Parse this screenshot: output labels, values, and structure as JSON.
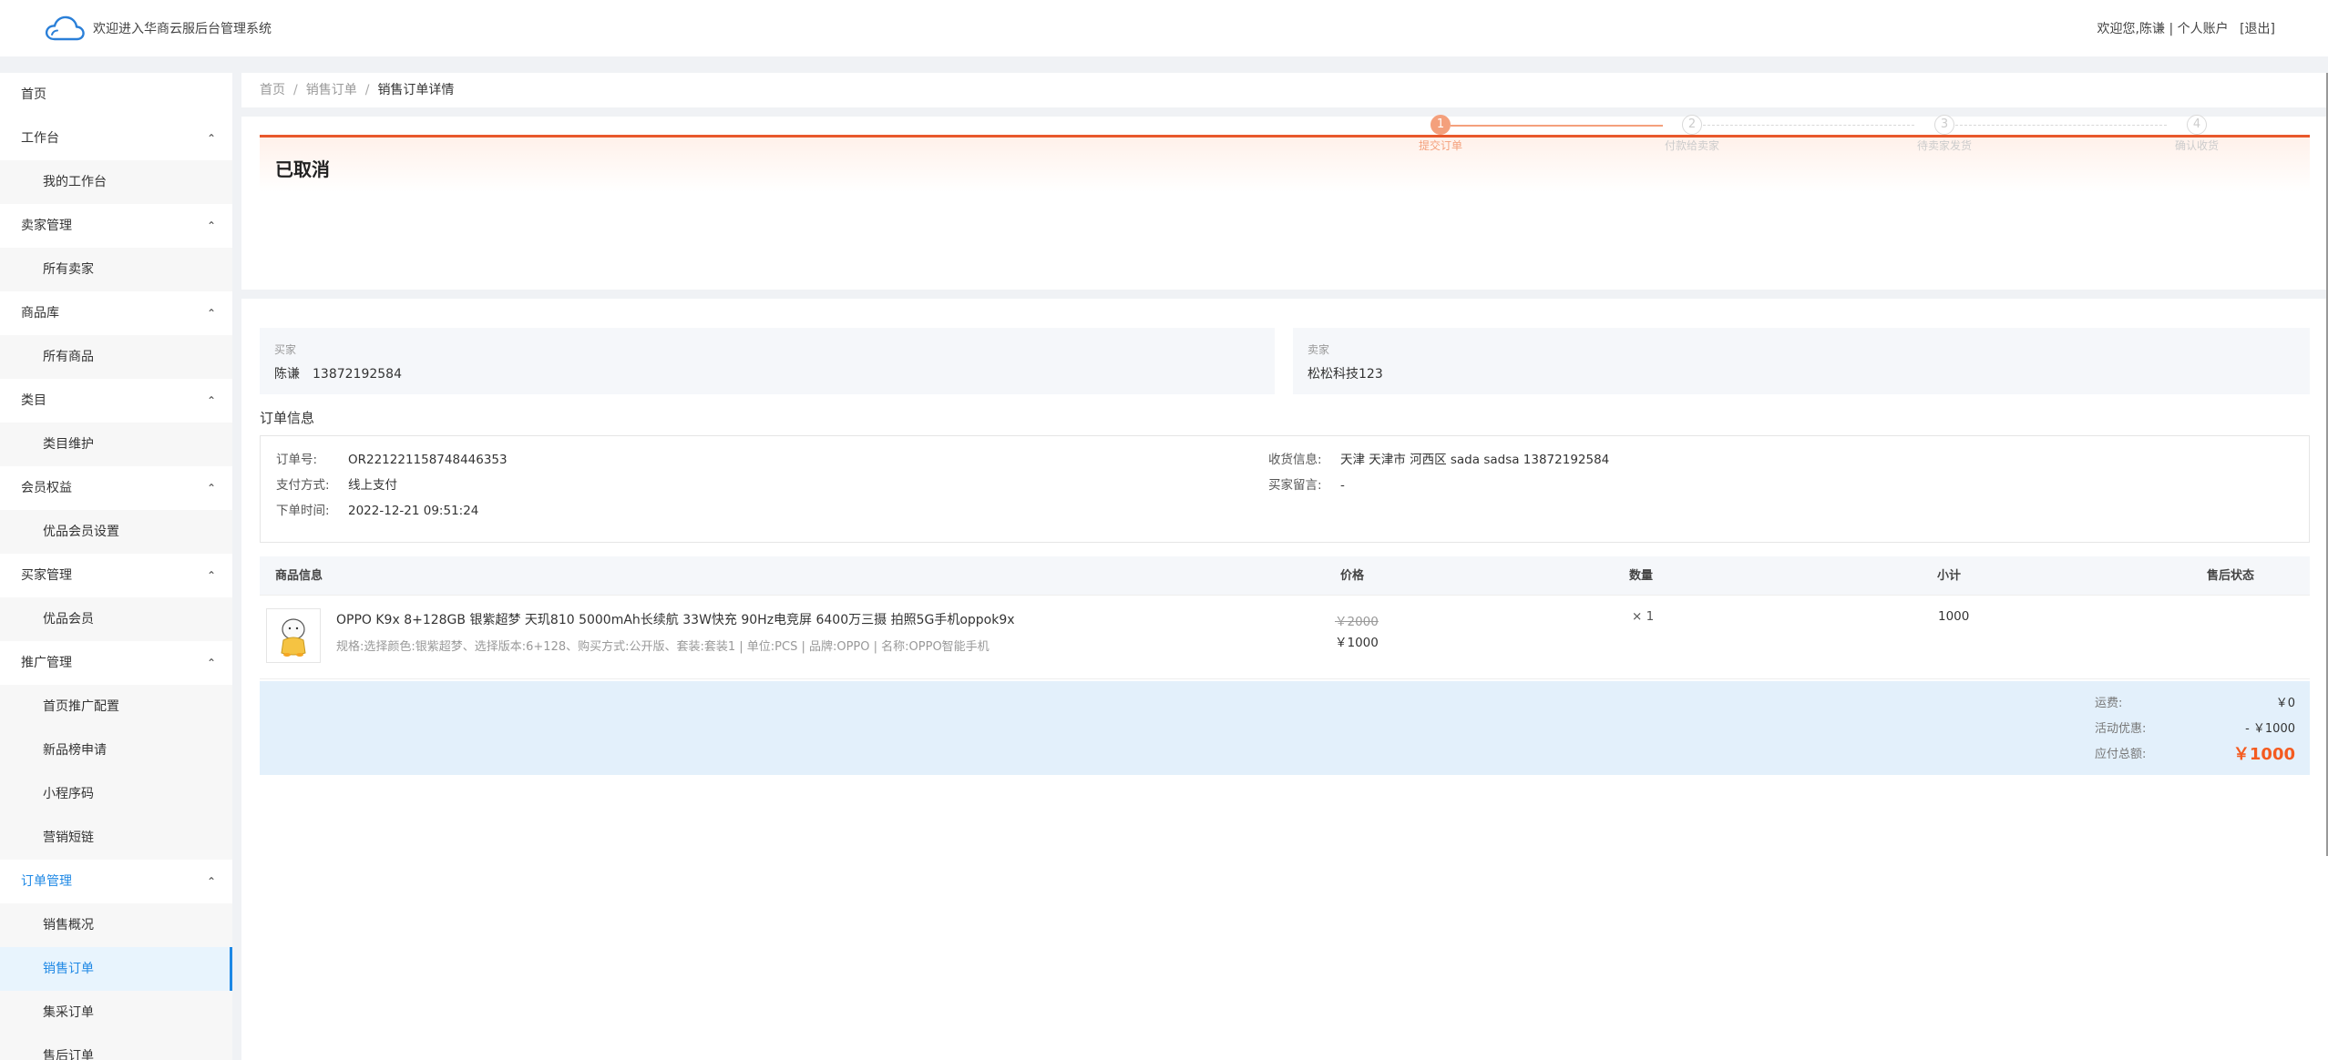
{
  "header": {
    "site_title": "欢迎进入华商云服后台管理系统",
    "greeting": "欢迎您,",
    "username": "陈谦",
    "divider": "|",
    "account_link": "个人账户",
    "logout_link": "[退出]"
  },
  "sidebar": {
    "items": [
      {
        "label": "首页",
        "level": 1
      },
      {
        "label": "工作台",
        "level": 1,
        "expandable": true
      },
      {
        "label": "我的工作台",
        "level": 2
      },
      {
        "label": "卖家管理",
        "level": 1,
        "expandable": true
      },
      {
        "label": "所有卖家",
        "level": 2
      },
      {
        "label": "商品库",
        "level": 1,
        "expandable": true
      },
      {
        "label": "所有商品",
        "level": 2
      },
      {
        "label": "类目",
        "level": 1,
        "expandable": true
      },
      {
        "label": "类目维护",
        "level": 2
      },
      {
        "label": "会员权益",
        "level": 1,
        "expandable": true
      },
      {
        "label": "优品会员设置",
        "level": 2
      },
      {
        "label": "买家管理",
        "level": 1,
        "expandable": true
      },
      {
        "label": "优品会员",
        "level": 2
      },
      {
        "label": "推广管理",
        "level": 1,
        "expandable": true
      },
      {
        "label": "首页推广配置",
        "level": 2
      },
      {
        "label": "新品榜申请",
        "level": 2
      },
      {
        "label": "小程序码",
        "level": 2
      },
      {
        "label": "营销短链",
        "level": 2
      },
      {
        "label": "订单管理",
        "level": 1,
        "expandable": true,
        "open": true
      },
      {
        "label": "销售概况",
        "level": 2
      },
      {
        "label": "销售订单",
        "level": 2,
        "active": true
      },
      {
        "label": "集采订单",
        "level": 2
      },
      {
        "label": "售后订单",
        "level": 2
      }
    ],
    "chevron": "⌃"
  },
  "breadcrumb": {
    "items": [
      "首页",
      "销售订单",
      "销售订单详情"
    ],
    "separator": "/"
  },
  "status": {
    "title": "已取消",
    "steps": [
      {
        "num": "1",
        "label": "提交订单",
        "done": true
      },
      {
        "num": "2",
        "label": "付款给卖家",
        "done": false
      },
      {
        "num": "3",
        "label": "待卖家发货",
        "done": false
      },
      {
        "num": "4",
        "label": "确认收货",
        "done": false
      }
    ]
  },
  "buyer": {
    "title": "买家",
    "name": "陈谦",
    "phone": "13872192584"
  },
  "seller": {
    "title": "卖家",
    "name": "松松科技123"
  },
  "order_info": {
    "section_title": "订单信息",
    "order_no_label": "订单号:",
    "order_no": "OR221221158748446353",
    "pay_method_label": "支付方式:",
    "pay_method": "线上支付",
    "order_time_label": "下单时间:",
    "order_time": "2022-12-21 09:51:24",
    "shipping_label": "收货信息:",
    "shipping": "天津 天津市 河西区 sada sadsa 13872192584",
    "buyer_note_label": "买家留言:",
    "buyer_note": "-"
  },
  "table": {
    "headers": [
      "商品信息",
      "价格",
      "数量",
      "小计",
      "售后状态"
    ],
    "rows": [
      {
        "name": "OPPO K9x 8+128GB 银紫超梦 天玑810 5000mAh长续航 33W快充 90Hz电竞屏 6400万三摄 拍照5G手机oppok9x",
        "spec": "规格:选择颜色:银紫超梦、选择版本:6+128、购买方式:公开版、套装:套装1 | 单位:PCS | 品牌:OPPO | 名称:OPPO智能手机",
        "price_old": "￥2000",
        "price_new": "￥1000",
        "qty": "× 1",
        "subtotal": "1000",
        "after_sale": ""
      }
    ]
  },
  "summary": {
    "shipping_label": "运费:",
    "shipping": "￥0",
    "discount_label": "活动优惠:",
    "discount": "- ￥1000",
    "total_label": "应付总额:",
    "total": "￥1000"
  },
  "colors": {
    "accent": "#1e88e5",
    "status_bar": "#e8582c",
    "step_done": "#f4a07c",
    "total": "#f45b20"
  }
}
